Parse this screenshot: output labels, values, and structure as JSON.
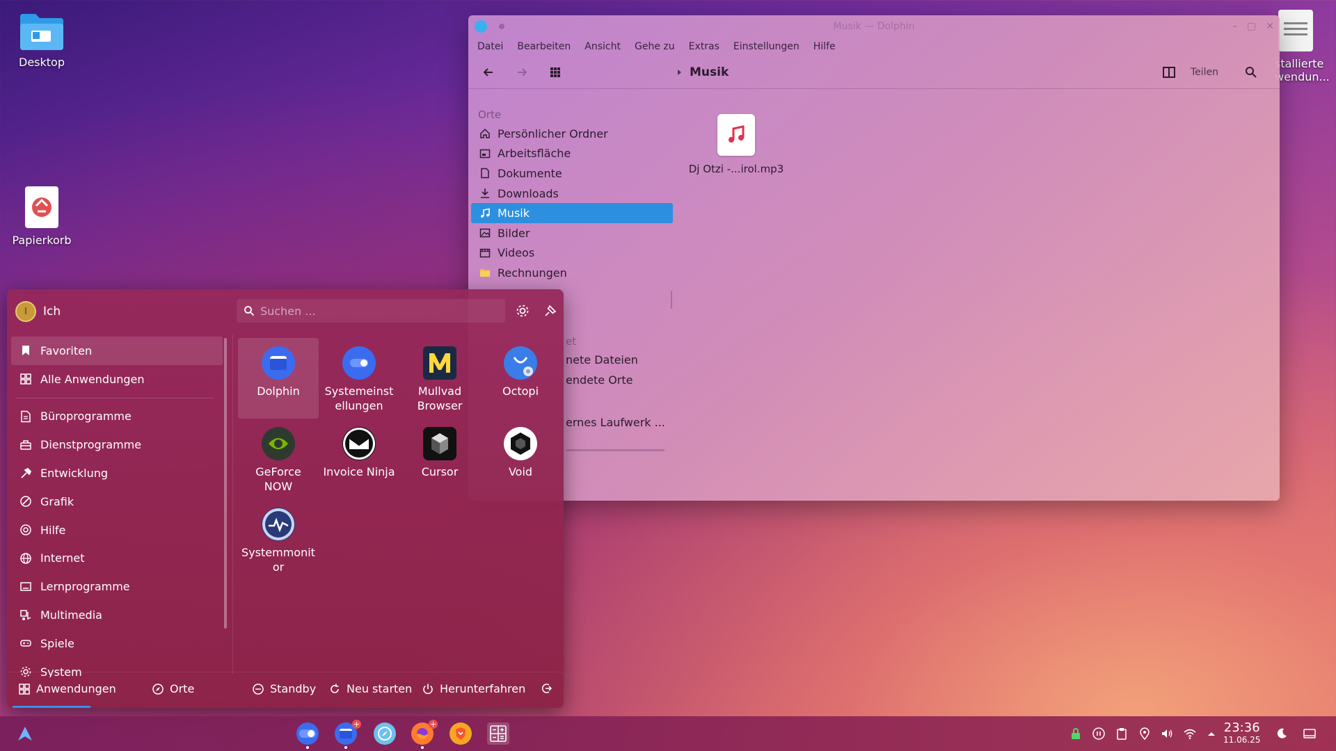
{
  "desktop": {
    "icons": [
      {
        "label": "Desktop",
        "icon": "folder-icon"
      },
      {
        "label": "Papierkorb",
        "icon": "trash-icon"
      },
      {
        "label": "stallierte\nwendun...",
        "icon": "document-icon"
      }
    ]
  },
  "dolphin": {
    "title": "Musik — Dolphin",
    "menu": [
      "Datei",
      "Bearbeiten",
      "Ansicht",
      "Gehe zu",
      "Extras",
      "Einstellungen",
      "Hilfe"
    ],
    "breadcrumb": "Musik",
    "share_label": "Teilen",
    "places_heading": "Orte",
    "places": [
      {
        "label": "Persönlicher Ordner",
        "icon": "home-icon"
      },
      {
        "label": "Arbeitsfläche",
        "icon": "desktop-icon"
      },
      {
        "label": "Dokumente",
        "icon": "document-icon"
      },
      {
        "label": "Downloads",
        "icon": "download-icon"
      },
      {
        "label": "Musik",
        "icon": "music-icon",
        "active": true
      },
      {
        "label": "Bilder",
        "icon": "image-icon"
      },
      {
        "label": "Videos",
        "icon": "video-icon"
      },
      {
        "label": "Rechnungen",
        "icon": "folder-icon"
      }
    ],
    "partial_labels": [
      "et",
      "nete Dateien",
      "endete Orte",
      "ernes Laufwerk ..."
    ],
    "files": [
      {
        "name": "Dj Otzi -...irol.mp3",
        "icon": "music-file-icon"
      }
    ]
  },
  "start_menu": {
    "user": "Ich",
    "avatar_letter": "I",
    "search_placeholder": "Suchen ...",
    "categories": [
      {
        "label": "Favoriten",
        "icon": "bookmark-icon",
        "active": true
      },
      {
        "label": "Alle Anwendungen",
        "icon": "grid-icon"
      },
      {
        "label": "Büroprogramme",
        "icon": "office-icon"
      },
      {
        "label": "Dienstprogramme",
        "icon": "utilities-icon"
      },
      {
        "label": "Entwicklung",
        "icon": "hammer-icon"
      },
      {
        "label": "Grafik",
        "icon": "graphics-icon"
      },
      {
        "label": "Hilfe",
        "icon": "help-icon"
      },
      {
        "label": "Internet",
        "icon": "globe-icon"
      },
      {
        "label": "Lernprogramme",
        "icon": "education-icon"
      },
      {
        "label": "Multimedia",
        "icon": "multimedia-icon"
      },
      {
        "label": "Spiele",
        "icon": "games-icon"
      },
      {
        "label": "System",
        "icon": "system-icon"
      }
    ],
    "apps": [
      {
        "label": "Dolphin",
        "icon": "dolphin-icon",
        "color": "#3b6cf0",
        "active": true
      },
      {
        "label": "Systemeinst ellungen",
        "icon": "settings-toggle-icon",
        "color": "#3b6cf0"
      },
      {
        "label": "Mullvad Browser",
        "icon": "mullvad-icon",
        "color": "#1b2a44"
      },
      {
        "label": "Octopi",
        "icon": "octopi-icon",
        "color": "#3b7de8"
      },
      {
        "label": "GeForce NOW",
        "icon": "geforce-icon",
        "color": "#2f3a2f"
      },
      {
        "label": "Invoice Ninja",
        "icon": "invoice-ninja-icon",
        "color": "#111111"
      },
      {
        "label": "Cursor",
        "icon": "cursor-icon",
        "color": "#111111"
      },
      {
        "label": "Void",
        "icon": "void-icon",
        "color": "#ffffff"
      },
      {
        "label": "Systemmonit or",
        "icon": "system-monitor-icon",
        "color": "#2a3a78"
      }
    ],
    "footer": {
      "apps": "Anwendungen",
      "places": "Orte",
      "standby": "Standby",
      "restart": "Neu starten",
      "shutdown": "Herunterfahren"
    }
  },
  "taskbar": {
    "time": "23:36",
    "date": "11.06.25"
  }
}
